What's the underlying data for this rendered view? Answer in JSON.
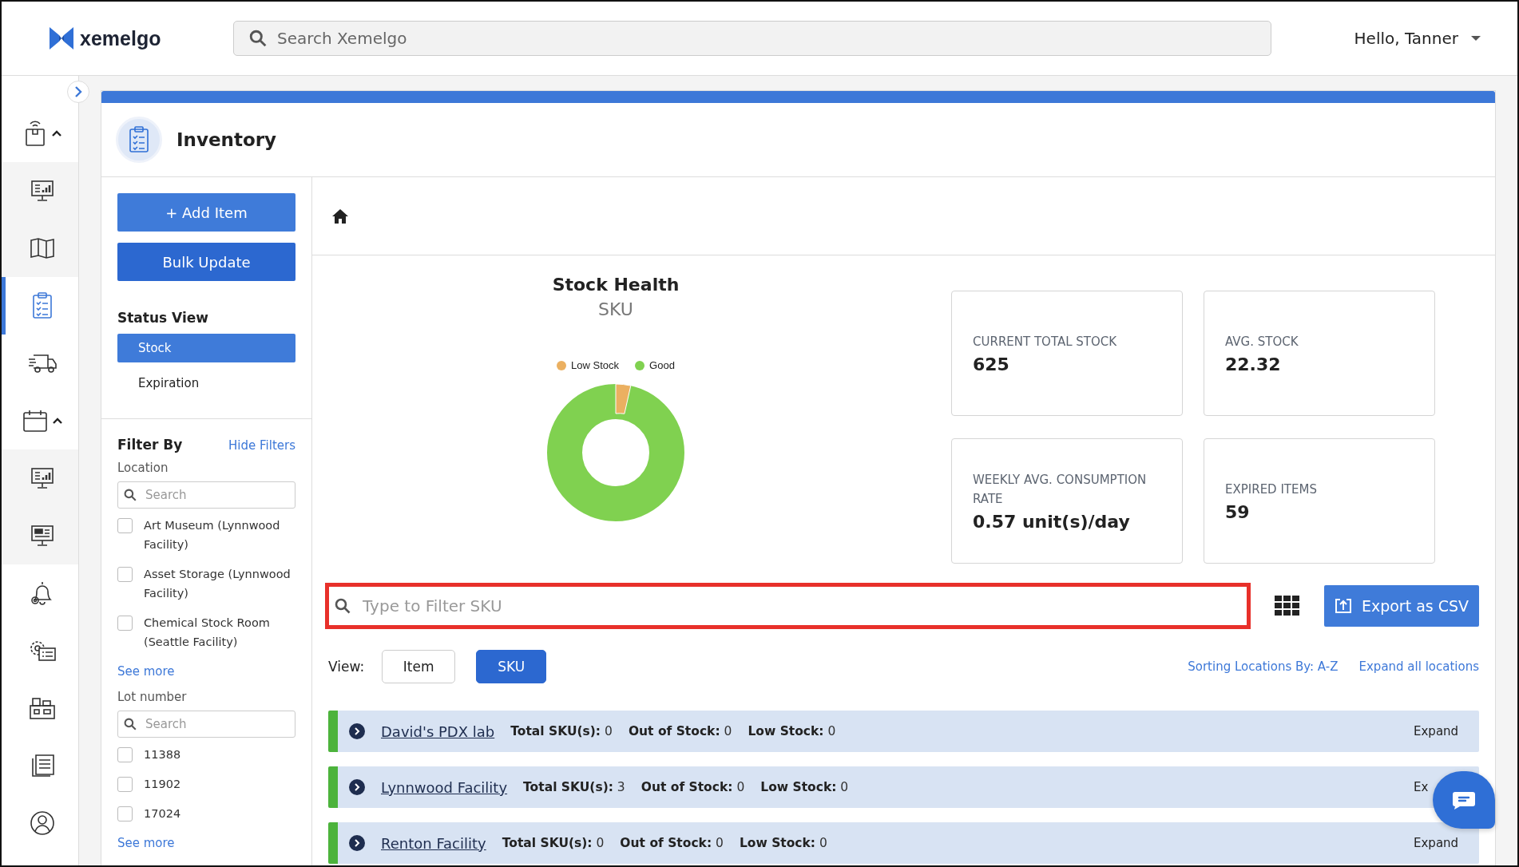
{
  "header": {
    "logo": "xemelgo",
    "search": {
      "placeholder": "Search Xemelgo"
    },
    "user": "Hello, Tanner"
  },
  "rail": [
    {
      "kind": "group",
      "expanded": true,
      "selected": false
    },
    {
      "kind": "sub",
      "selected": false
    },
    {
      "kind": "sub",
      "selected": false
    },
    {
      "kind": "item",
      "selected": true
    },
    {
      "kind": "item",
      "selected": false
    },
    {
      "kind": "group",
      "expanded": true,
      "selected": false
    },
    {
      "kind": "sub",
      "selected": false
    },
    {
      "kind": "sub",
      "selected": false
    },
    {
      "kind": "item",
      "selected": false
    },
    {
      "kind": "item",
      "selected": false
    },
    {
      "kind": "item",
      "selected": false
    },
    {
      "kind": "item",
      "selected": false
    },
    {
      "kind": "item",
      "selected": false
    }
  ],
  "page": {
    "title": "Inventory"
  },
  "actions": [
    "+ Add Item",
    "Bulk Update"
  ],
  "status_view": {
    "title": "Status View",
    "options": [
      {
        "label": "Stock",
        "selected": true
      },
      {
        "label": "Expiration",
        "selected": false
      }
    ]
  },
  "filters": {
    "title": "Filter By",
    "toggle": "Hide Filters",
    "groups": [
      {
        "label": "Location",
        "search_placeholder": "Search",
        "options": [
          {
            "label": "Art Museum (Lynnwood Facility)",
            "checked": false
          },
          {
            "label": "Asset Storage (Lynnwood Facility)",
            "checked": false
          },
          {
            "label": "Chemical Stock Room (Seattle Facility)",
            "checked": false
          }
        ],
        "more": "See more"
      },
      {
        "label": "Lot number",
        "search_placeholder": "Search",
        "options": [
          {
            "label": "11388",
            "checked": false
          },
          {
            "label": "11902",
            "checked": false
          },
          {
            "label": "17024",
            "checked": false
          }
        ],
        "more": "See more"
      }
    ]
  },
  "stock_health": {
    "title": "Stock Health",
    "subtitle": "SKU",
    "legend": [
      {
        "label": "Low Stock",
        "color": "#ebb061"
      },
      {
        "label": "Good",
        "color": "#80d150"
      }
    ]
  },
  "metrics": [
    {
      "label": "CURRENT TOTAL STOCK",
      "value": "625"
    },
    {
      "label": "AVG. STOCK",
      "value": "22.32"
    },
    {
      "label": "WEEKLY AVG. CONSUMPTION RATE",
      "value": "0.57 unit(s)/day"
    },
    {
      "label": "EXPIRED ITEMS",
      "value": "59"
    }
  ],
  "sku_filter": {
    "placeholder": "Type to Filter SKU"
  },
  "export": "Export as CSV",
  "view": {
    "label": "View:",
    "options": [
      {
        "label": "Item",
        "selected": false
      },
      {
        "label": "SKU",
        "selected": true
      }
    ]
  },
  "sorting": "Sorting Locations By: A-Z",
  "expand_all": "Expand all locations",
  "locations": [
    {
      "name": "David's PDX lab",
      "stats": [
        {
          "label": "Total SKU(s):",
          "value": "0"
        },
        {
          "label": "Out of Stock:",
          "value": "0"
        },
        {
          "label": "Low Stock:",
          "value": "0"
        }
      ],
      "expand": "Expand",
      "color": "#4cb33c"
    },
    {
      "name": "Lynnwood Facility",
      "stats": [
        {
          "label": "Total SKU(s):",
          "value": "3"
        },
        {
          "label": "Out of Stock:",
          "value": "0"
        },
        {
          "label": "Low Stock:",
          "value": "0"
        }
      ],
      "expand": "Ex",
      "color": "#4cb33c"
    },
    {
      "name": "Renton Facility",
      "stats": [
        {
          "label": "Total SKU(s):",
          "value": "0"
        },
        {
          "label": "Out of Stock:",
          "value": "0"
        },
        {
          "label": "Low Stock:",
          "value": "0"
        }
      ],
      "expand": "Expand",
      "color": "#4cb33c"
    }
  ]
}
